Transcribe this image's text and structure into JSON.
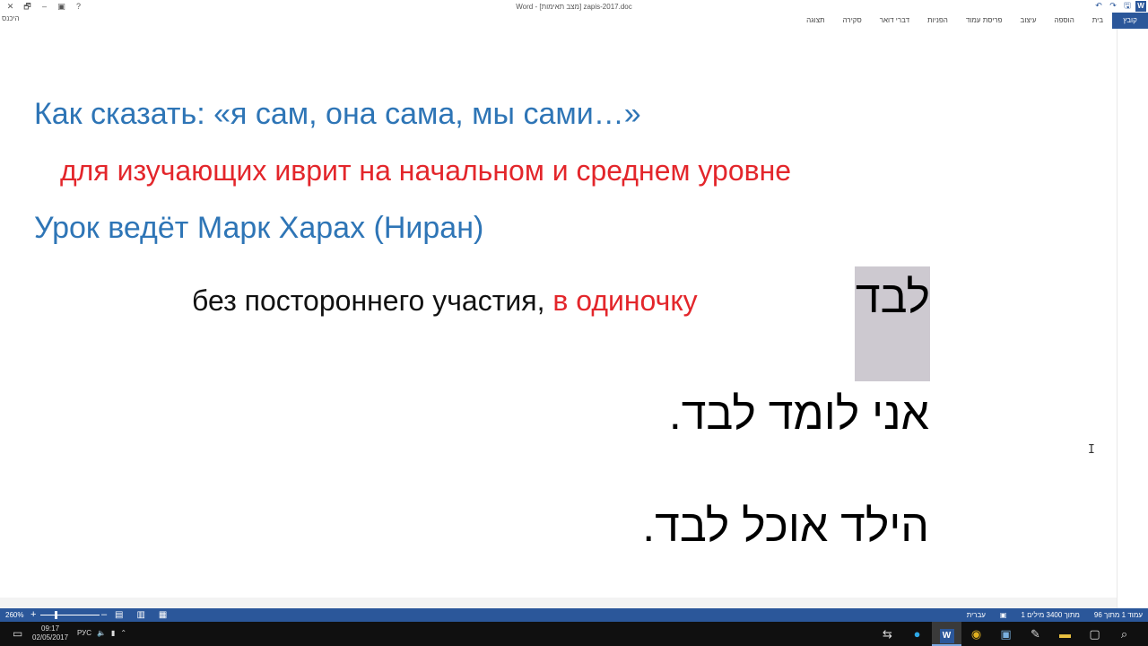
{
  "titlebar": {
    "title": "Word - [מצב תאימות] zapis-2017.doc",
    "left_controls": [
      "✕",
      "🗗",
      "–",
      "▣",
      "?"
    ],
    "right_controls": [
      "↶",
      "↷",
      "🖫"
    ]
  },
  "ribbon": {
    "signin": "היכנס",
    "tabs": [
      {
        "label": "קובץ",
        "active": true
      },
      {
        "label": "בית"
      },
      {
        "label": "הוספה"
      },
      {
        "label": "עיצוב"
      },
      {
        "label": "פריסת עמוד"
      },
      {
        "label": "הפניות"
      },
      {
        "label": "דברי דואר"
      },
      {
        "label": "סקירה"
      },
      {
        "label": "תצוגה"
      }
    ]
  },
  "document": {
    "title_line": "Как сказать: «я сам, она сама, мы сами…»",
    "subtitle_line": "для изучающих иврит на начальном и среднем уровне",
    "teacher_line": "Урок ведёт Марк Харах (Ниран)",
    "definition": "без постороннего участия, ",
    "definition_highlight": "в одиночку",
    "word": "לבד",
    "example1": "אני לומד לבד.",
    "example2": "הילד אוכל לבד."
  },
  "statusbar": {
    "zoom": "260%",
    "page_info": "עמוד 1 מתוך 96",
    "word_count": "1 מתוך 3400 מילים",
    "language": "עברית"
  },
  "taskbar": {
    "time": "09:17",
    "date": "02/05/2017",
    "lang": "РУС"
  },
  "colors": {
    "accent": "#2b579a",
    "blue_text": "#2e75b6",
    "red_text": "#e3262b",
    "highlight": "#cdc9d0"
  }
}
